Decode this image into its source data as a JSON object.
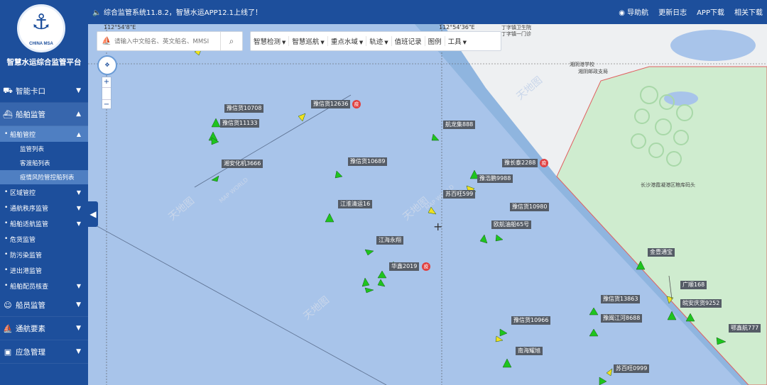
{
  "platform": {
    "title": "智慧水运综合监管平台",
    "logo_text": "CHINA MSA"
  },
  "notice": "综合监管系统11.8.2，智慧水运APP12.1上线了！",
  "top_links": [
    {
      "label": "导助航"
    },
    {
      "label": "更新日志"
    },
    {
      "label": "APP下载"
    },
    {
      "label": "相关下载"
    }
  ],
  "sidebar": {
    "items": [
      {
        "label": "智能卡口"
      },
      {
        "label": "船舶监管"
      },
      {
        "label": "船舶管控"
      },
      {
        "label": "监管列表"
      },
      {
        "label": "客渡船列表"
      },
      {
        "label": "疫情风险管控船列表"
      },
      {
        "label": "区域管控"
      },
      {
        "label": "通航秩序监管"
      },
      {
        "label": "船舶适航监管"
      },
      {
        "label": "危货监管"
      },
      {
        "label": "防污染监管"
      },
      {
        "label": "进出港监管"
      },
      {
        "label": "船舶配员核查"
      },
      {
        "label": "船员监管"
      },
      {
        "label": "通航要素"
      },
      {
        "label": "应急管理"
      }
    ]
  },
  "search": {
    "placeholder": "请输入中文船名、英文船名、MMSI"
  },
  "toolbar": [
    {
      "label": "智慧检测",
      "dropdown": true
    },
    {
      "label": "智慧巡航",
      "dropdown": true
    },
    {
      "label": "重点水域",
      "dropdown": true
    },
    {
      "label": "轨迹",
      "dropdown": true
    },
    {
      "label": "值班记录",
      "dropdown": false
    },
    {
      "label": "图例",
      "dropdown": false
    },
    {
      "label": "工具",
      "dropdown": true
    }
  ],
  "map": {
    "coord_left": "112°54'8\"E",
    "coord_mid": "112°54'36\"E",
    "places": [
      "丁字镇卫生院",
      "丁字镇一门诊",
      "湘阴港学校",
      "湘阴邮政支局",
      "长沙港霞凝港区粮库码头"
    ],
    "watermarks": [
      "天地图",
      "MAP WORLD"
    ],
    "ship_labels": [
      "豫信货10708",
      "豫信货12636",
      "豫信货11133",
      "航龙集888",
      "湘安化机3666",
      "豫信货10689",
      "豫长泰2288",
      "豫浩鹏9988",
      "苏百旺599",
      "江淮清运16",
      "豫信货10980",
      "欧航油船65号",
      "江海永翔",
      "华鑫2019",
      "金豊通宝",
      "广顺168",
      "豫信货13863",
      "皖安庆货9252",
      "豫闽江河8688",
      "豫信货10966",
      "鄂鑫航777",
      "南海耀旭",
      "苏百旺0999"
    ],
    "epidemic_badge": "疫"
  },
  "colors": {
    "primary": "#1d4f9c",
    "water": "#a8c4ea",
    "channel": "#8fb5df",
    "port_area": "#cfeccf",
    "ship_green": "#1ec41e",
    "ship_yellow": "#f0e020",
    "badge_red": "#e04040"
  }
}
